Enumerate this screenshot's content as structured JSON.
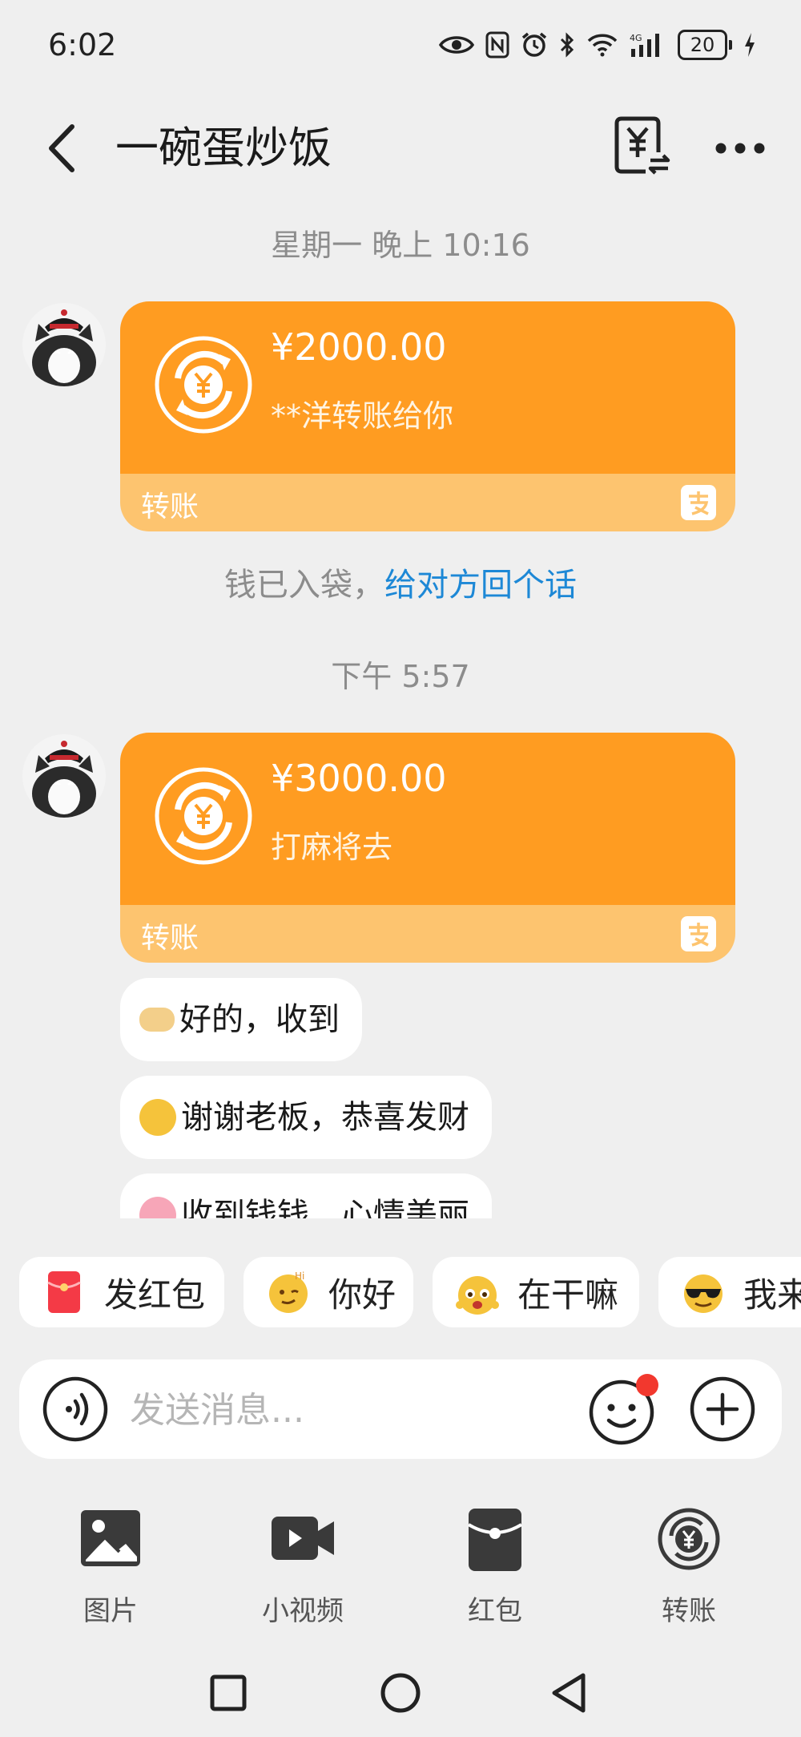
{
  "status_bar": {
    "time": "6:02",
    "battery": "20"
  },
  "header": {
    "title": "一碗蛋炒饭",
    "back_icon": "chevron-left-icon",
    "bill_icon": "yuan-bill-icon",
    "more_icon": "more-dots-icon"
  },
  "chat": {
    "messages": [
      {
        "timestamp": "星期一 晚上 10:16",
        "transfer": {
          "amount": "¥2000.00",
          "note": "**洋转账给你",
          "label": "转账"
        },
        "system_note": {
          "text": "钱已入袋，",
          "link": "给对方回个话"
        }
      },
      {
        "timestamp": "下午 5:57",
        "transfer": {
          "amount": "¥3000.00",
          "note": "打麻将去",
          "label": "转账"
        }
      }
    ],
    "replies": [
      {
        "text": "好的，收到",
        "emoji": "handshake-emoji"
      },
      {
        "text": "谢谢老板，恭喜发财",
        "emoji": "hug-face-emoji"
      },
      {
        "text": "收到钱钱，心情美丽",
        "emoji": "star-eyes-emoji"
      }
    ]
  },
  "quick_replies": [
    {
      "label": "发红包",
      "icon": "red-envelope-icon"
    },
    {
      "label": "你好",
      "icon": "hi-emoji"
    },
    {
      "label": "在干嘛",
      "icon": "what-doing-emoji"
    },
    {
      "label": "我来",
      "icon": "sunglasses-emoji"
    }
  ],
  "input_bar": {
    "placeholder": "发送消息..."
  },
  "tools": [
    {
      "label": "图片",
      "icon": "image-icon"
    },
    {
      "label": "小视频",
      "icon": "video-icon"
    },
    {
      "label": "红包",
      "icon": "red-packet-icon"
    },
    {
      "label": "转账",
      "icon": "transfer-icon"
    }
  ],
  "colors": {
    "transfer_orange": "#ff9c21",
    "transfer_light": "#fdc46f",
    "link_blue": "#1d88d6",
    "background": "#efefef"
  }
}
